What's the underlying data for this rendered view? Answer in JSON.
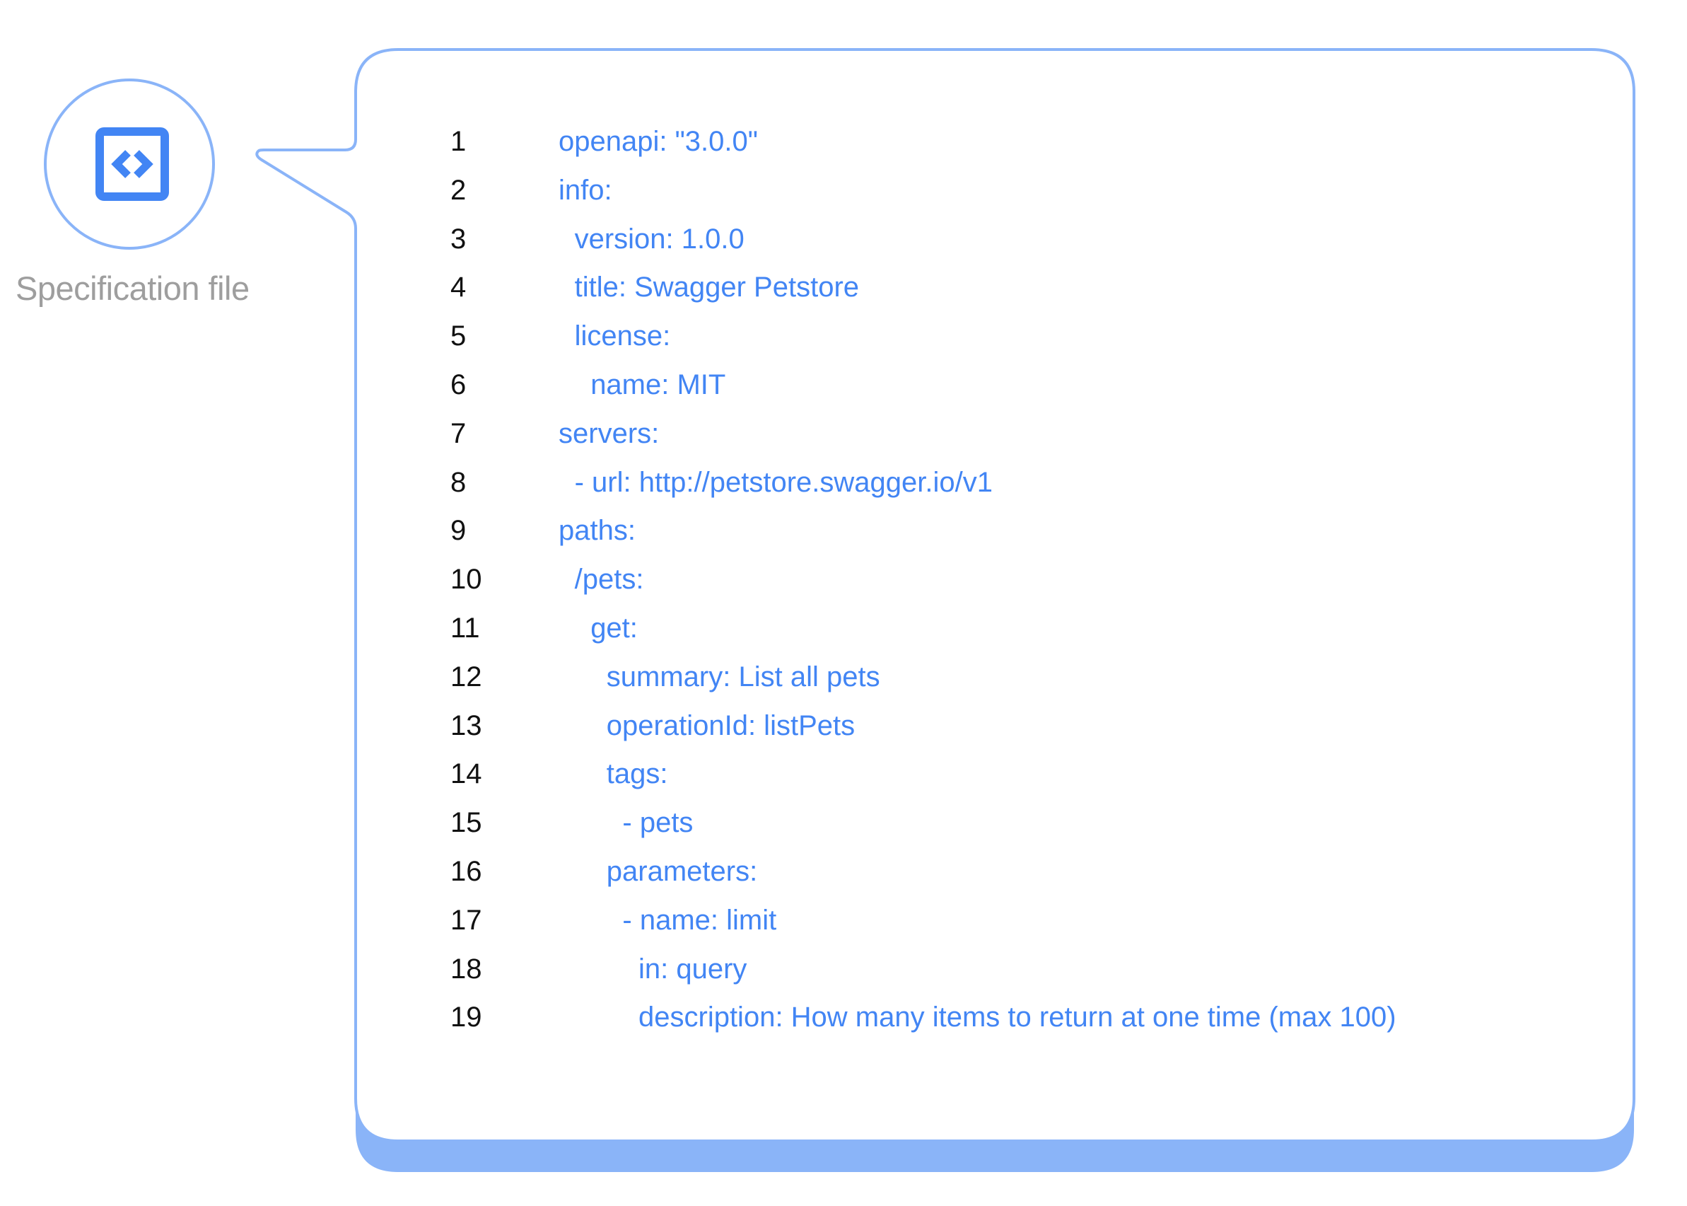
{
  "caption": "Specification file",
  "icon": "code-brackets-icon",
  "colors": {
    "accent": "#4285f4",
    "outline": "#8ab4f8",
    "line_number": "#111111",
    "caption": "#9e9e9e"
  },
  "code": {
    "language": "yaml",
    "lines": [
      {
        "n": "1",
        "indent": 0,
        "text": "openapi: \"3.0.0\""
      },
      {
        "n": "2",
        "indent": 0,
        "text": "info:"
      },
      {
        "n": "3",
        "indent": 1,
        "text": "version: 1.0.0"
      },
      {
        "n": "4",
        "indent": 1,
        "text": "title: Swagger Petstore"
      },
      {
        "n": "5",
        "indent": 1,
        "text": "license:"
      },
      {
        "n": "6",
        "indent": 2,
        "text": "name: MIT"
      },
      {
        "n": "7",
        "indent": 0,
        "text": "servers:"
      },
      {
        "n": "8",
        "indent": 1,
        "text": "- url: http://petstore.swagger.io/v1"
      },
      {
        "n": "9",
        "indent": 0,
        "text": "paths:"
      },
      {
        "n": "10",
        "indent": 1,
        "text": "/pets:"
      },
      {
        "n": "11",
        "indent": 2,
        "text": "get:"
      },
      {
        "n": "12",
        "indent": 3,
        "text": "summary: List all pets"
      },
      {
        "n": "13",
        "indent": 3,
        "text": "operationId: listPets"
      },
      {
        "n": "14",
        "indent": 3,
        "text": "tags:"
      },
      {
        "n": "15",
        "indent": 4,
        "text": "- pets"
      },
      {
        "n": "16",
        "indent": 3,
        "text": "parameters:"
      },
      {
        "n": "17",
        "indent": 4,
        "text": "- name: limit"
      },
      {
        "n": "18",
        "indent": 5,
        "text": "in: query"
      },
      {
        "n": "19",
        "indent": 5,
        "text": "description: How many items to return at one time (max 100)"
      }
    ]
  }
}
